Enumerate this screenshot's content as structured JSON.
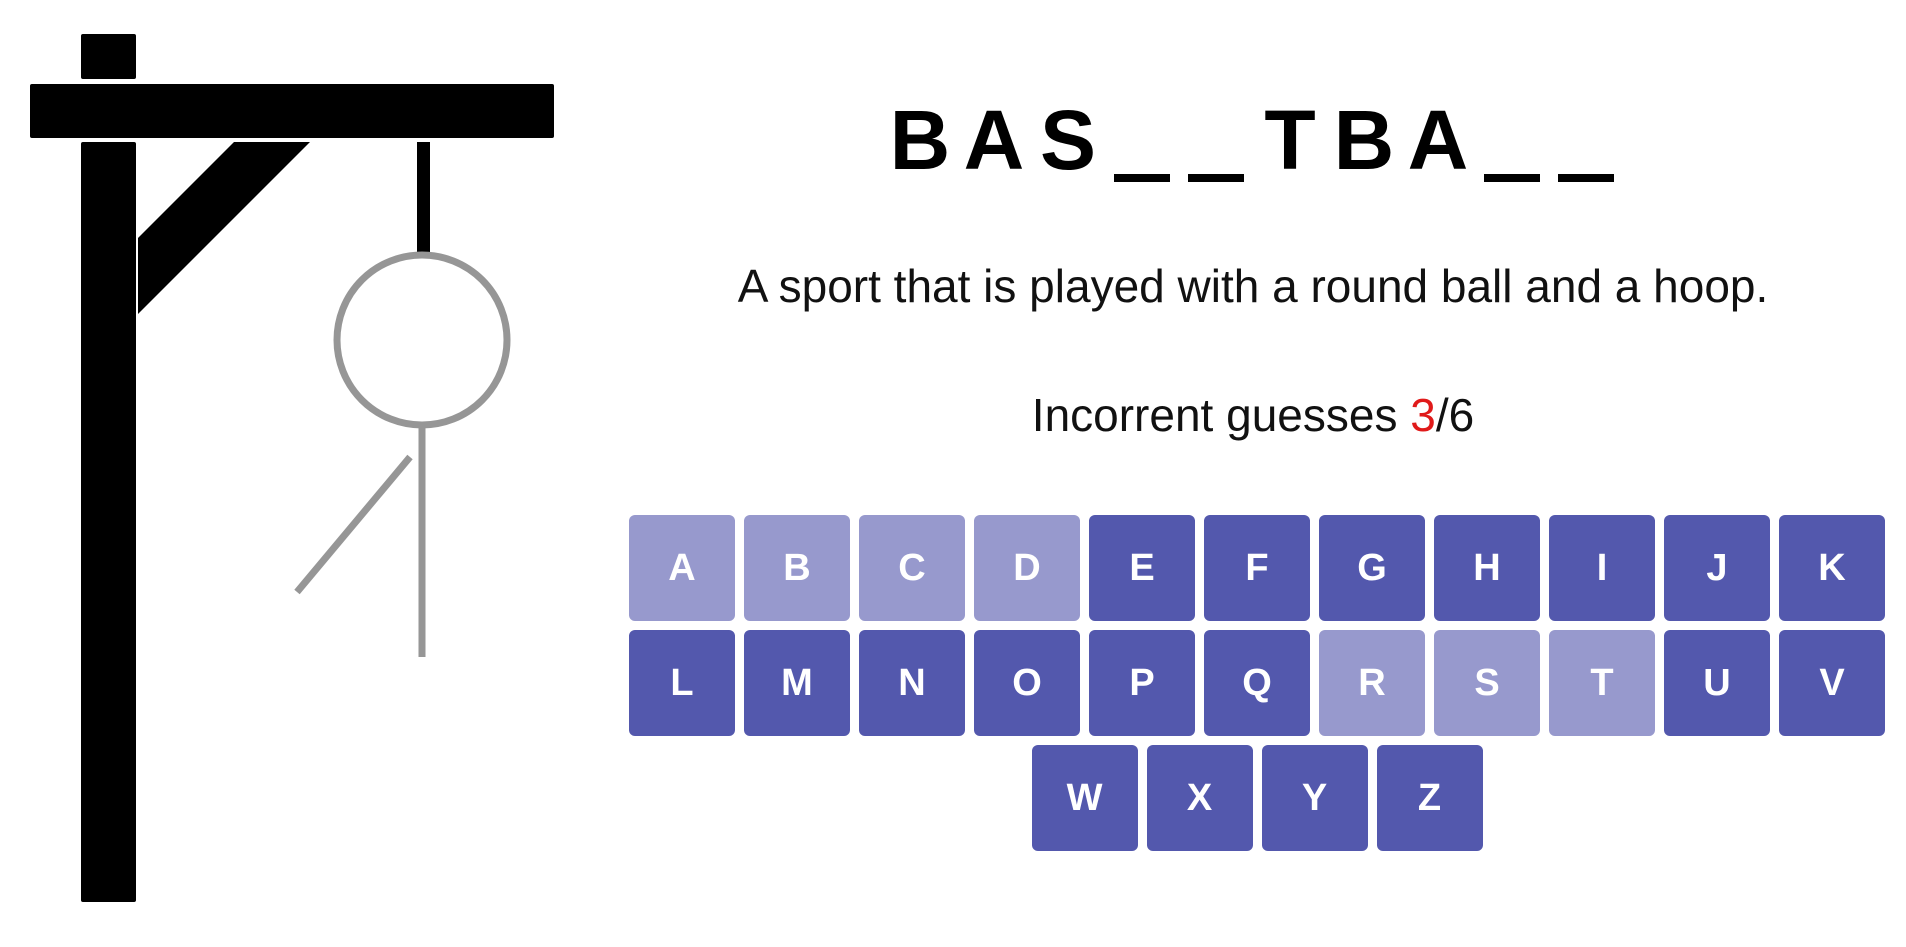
{
  "puzzle": {
    "slots": [
      "B",
      "A",
      "S",
      "",
      "",
      "T",
      "B",
      "A",
      "",
      ""
    ]
  },
  "hint": "A sport that is played with a round ball and a hoop.",
  "status": {
    "prefix": "Incorrent guesses ",
    "count": "3",
    "suffix": "/6"
  },
  "keyboard": {
    "rows": [
      [
        {
          "letter": "A",
          "used": true
        },
        {
          "letter": "B",
          "used": true
        },
        {
          "letter": "C",
          "used": true
        },
        {
          "letter": "D",
          "used": true
        },
        {
          "letter": "E",
          "used": false
        },
        {
          "letter": "F",
          "used": false
        },
        {
          "letter": "G",
          "used": false
        },
        {
          "letter": "H",
          "used": false
        },
        {
          "letter": "I",
          "used": false
        },
        {
          "letter": "J",
          "used": false
        },
        {
          "letter": "K",
          "used": false
        }
      ],
      [
        {
          "letter": "L",
          "used": false
        },
        {
          "letter": "M",
          "used": false
        },
        {
          "letter": "N",
          "used": false
        },
        {
          "letter": "O",
          "used": false
        },
        {
          "letter": "P",
          "used": false
        },
        {
          "letter": "Q",
          "used": false
        },
        {
          "letter": "R",
          "used": true
        },
        {
          "letter": "S",
          "used": true
        },
        {
          "letter": "T",
          "used": true
        },
        {
          "letter": "U",
          "used": false
        },
        {
          "letter": "V",
          "used": false
        }
      ],
      [
        {
          "letter": "W",
          "used": false
        },
        {
          "letter": "X",
          "used": false
        },
        {
          "letter": "Y",
          "used": false
        },
        {
          "letter": "Z",
          "used": false
        }
      ]
    ]
  },
  "hangman": {
    "parts_shown": [
      "head",
      "body",
      "left-arm"
    ]
  },
  "colors": {
    "gallows": "#000000",
    "figure": "#969696",
    "key_active": "#5358ad",
    "key_used": "#9799cd",
    "wrong_count": "#e01a1a"
  }
}
